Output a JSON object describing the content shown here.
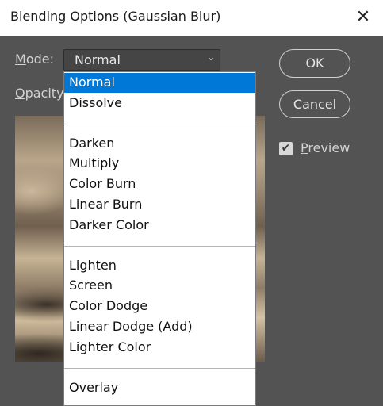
{
  "window": {
    "title": "Blending Options (Gaussian Blur)",
    "close_glyph": "✕"
  },
  "mode": {
    "label_underlined": "M",
    "label_rest": "ode:",
    "value": "Normal",
    "chevron": "⌄"
  },
  "opacity": {
    "label_underlined": "O",
    "label_rest": "pacity"
  },
  "buttons": {
    "ok": "OK",
    "cancel": "Cancel"
  },
  "preview": {
    "checked": true,
    "check_glyph": "✔",
    "label_underlined": "P",
    "label_rest": "review"
  },
  "dropdown": {
    "groups": [
      [
        "Normal",
        "Dissolve"
      ],
      [
        "Darken",
        "Multiply",
        "Color Burn",
        "Linear Burn",
        "Darker Color"
      ],
      [
        "Lighten",
        "Screen",
        "Color Dodge",
        "Linear Dodge (Add)",
        "Lighter Color"
      ],
      [
        "Overlay"
      ]
    ],
    "selected": "Normal"
  },
  "colors": {
    "dialog_bg": "#535353",
    "selection": "#0078d7"
  }
}
